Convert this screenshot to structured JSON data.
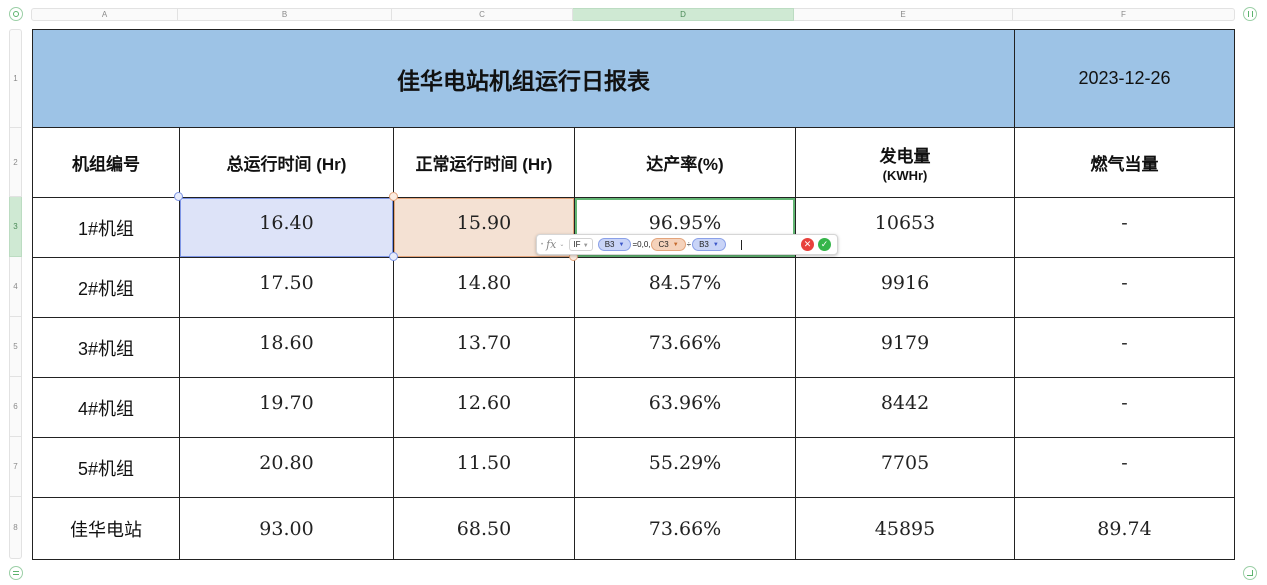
{
  "columns": [
    {
      "id": "A",
      "selected": false
    },
    {
      "id": "B",
      "selected": false
    },
    {
      "id": "C",
      "selected": false
    },
    {
      "id": "D",
      "selected": true
    },
    {
      "id": "E",
      "selected": false
    },
    {
      "id": "F",
      "selected": false
    }
  ],
  "rows": [
    "1",
    "2",
    "3",
    "4",
    "5",
    "6",
    "7",
    "8"
  ],
  "selected_row": "3",
  "title": "佳华电站机组运行日报表",
  "date": "2023-12-26",
  "headers": {
    "unit": "机组编号",
    "total_hours": "总运行时间 (Hr)",
    "normal_hours": "正常运行时间 (Hr)",
    "rate": "达产率(%)",
    "output": "发电量",
    "output_unit": "(KWHr)",
    "gas": "燃气当量"
  },
  "table_rows": [
    {
      "unit": "1#机组",
      "total": "16.40",
      "normal": "15.90",
      "rate": "96.95%",
      "output": "10653",
      "gas": "-"
    },
    {
      "unit": "2#机组",
      "total": "17.50",
      "normal": "14.80",
      "rate": "84.57%",
      "output": "9916",
      "gas": "-"
    },
    {
      "unit": "3#机组",
      "total": "18.60",
      "normal": "13.70",
      "rate": "73.66%",
      "output": "9179",
      "gas": "-"
    },
    {
      "unit": "4#机组",
      "total": "19.70",
      "normal": "12.60",
      "rate": "63.96%",
      "output": "8442",
      "gas": "-"
    },
    {
      "unit": "5#机组",
      "total": "20.80",
      "normal": "11.50",
      "rate": "55.29%",
      "output": "7705",
      "gas": "-"
    },
    {
      "unit": "佳华电站",
      "total": "93.00",
      "normal": "68.50",
      "rate": "73.66%",
      "output": "45895",
      "gas": "89.74"
    }
  ],
  "formula": {
    "function": "IF",
    "ref1": "B3",
    "text1": "=0,0,",
    "ref2": "C3",
    "op": "÷",
    "ref3": "B3"
  },
  "colors": {
    "title_fill": "#9dc3e6",
    "ref_blue": "#dde3f8",
    "ref_orange": "#f4e1d3",
    "selection_green": "#62b573",
    "cancel": "#e8413c",
    "confirm": "#35b54a"
  }
}
